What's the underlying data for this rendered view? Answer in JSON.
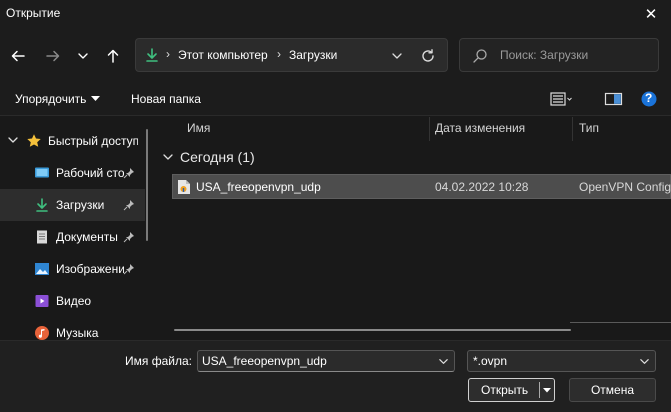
{
  "window": {
    "title": "Открытие",
    "close_glyph": "✕"
  },
  "nav": {
    "back_icon": "arrow-left-icon",
    "forward_icon": "arrow-right-icon",
    "recent_icon": "chevron-down-icon",
    "up_icon": "arrow-up-icon",
    "breadcrumbs": [
      "Этот компьютер",
      "Загрузки"
    ],
    "crumb_separator": "›",
    "refresh_icon": "refresh-icon",
    "search_placeholder": "Поиск: Загрузки"
  },
  "toolbar": {
    "organize_label": "Упорядочить",
    "new_folder_label": "Новая папка",
    "view_icon": "view-list-icon",
    "preview_icon": "preview-pane-icon",
    "help_glyph": "?"
  },
  "sidebar": {
    "items": [
      {
        "label": "Быстрый доступ",
        "icon": "star-icon",
        "pinned": false
      },
      {
        "label": "Рабочий стол",
        "icon": "desktop-icon",
        "pinned": true
      },
      {
        "label": "Загрузки",
        "icon": "download-icon",
        "pinned": true,
        "selected": true
      },
      {
        "label": "Документы",
        "icon": "document-icon",
        "pinned": true
      },
      {
        "label": "Изображения",
        "icon": "image-icon",
        "pinned": true
      },
      {
        "label": "Видео",
        "icon": "video-icon",
        "pinned": false
      },
      {
        "label": "Музыка",
        "icon": "music-icon",
        "pinned": false
      }
    ]
  },
  "columns": {
    "name": "Имя",
    "date": "Дата изменения",
    "type": "Тип"
  },
  "groups": [
    {
      "label": "Сегодня (1)",
      "files": [
        {
          "name": "USA_freeopenvpn_udp",
          "date": "04.02.2022 10:28",
          "type": "OpenVPN Config"
        }
      ]
    }
  ],
  "footer": {
    "filename_label": "Имя файла:",
    "filename_value": "USA_freeopenvpn_udp",
    "filetype_value": "*.ovpn",
    "open_label": "Открыть",
    "cancel_label": "Отмена"
  },
  "colors": {
    "accent": "#4cc2ff",
    "download_green": "#3fbf7f",
    "star": "#f5c13b"
  }
}
